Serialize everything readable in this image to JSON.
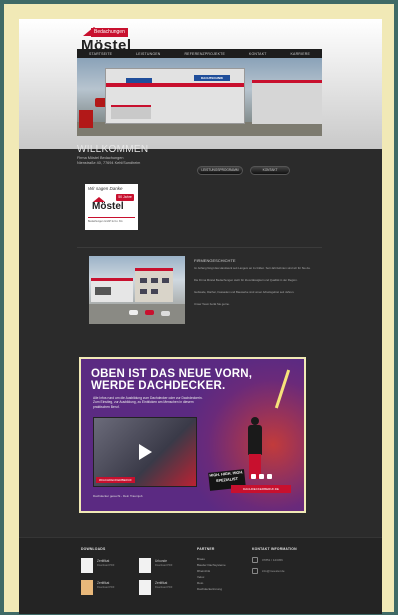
{
  "brand": {
    "tag": "Bedachungen",
    "name": "Möstel",
    "sub": "GmbH & Co. KG"
  },
  "nav": [
    "STARTSEITE",
    "LEISTUNGEN",
    "REFERENZPROJEKTE",
    "KONTAKT",
    "KARRIERE"
  ],
  "hero": {
    "building_sign": "DACHTECHNIK"
  },
  "welcome": {
    "title": "WILLKOMMEN",
    "line1": "Firma Möstel Bedachungen",
    "line2": "Nienstraße 40, 77694 Kehl/Sundheim",
    "btn_primary": "LEISTUNGSPROGRAMM",
    "btn_secondary": "KONTAKT"
  },
  "badge": {
    "script": "Wir sagen Danke",
    "jubilee": "50 Jahre",
    "name": "Möstel",
    "footer": "Bedachungen GmbH & Co. KG"
  },
  "firm": {
    "title": "FIRMENGESCHICHTE",
    "p1": "Im Anfang fängt das Handwerk seit Langem an zu bilden. Seit Jahrzehnten sind wir für Sie da.",
    "p2": "Die Firma Möstel Bedachungen steht für Zuverlässigkeit und Qualität in der Region.",
    "p3": "Gebäude, Dächer, Fassaden und Bauwerke sind unser Arbeitsgebiet seit Jahren.",
    "p4": "Unser Team berät Sie gerne."
  },
  "ad": {
    "headline1": "OBEN IST DAS NEUE VORN,",
    "headline2": "WERDE DACHDECKER.",
    "copy": "Alle Infos rund um die Ausbildung zum Dachdecker oder zur Dachdeckerin. Zum Einstieg, zur Ausbildung, zu Einblicken am Menschen in diesem praktischen Beruf.",
    "video_tag": "#DACHDECKERBERUF",
    "caption": "Dachdecker gesucht - Dein Traumjob",
    "stamp1": "HIGH. HIGH. HIGH.",
    "stamp2": "SPEZIALIST",
    "cta": "DACHDECKERBERUF.DE"
  },
  "footer": {
    "downloads_title": "DOWNLOADS",
    "partners_title": "PARTNER",
    "contact_title": "KONTAKT INFORMATION",
    "docs": [
      {
        "title": "Zertifikat",
        "sub": "Download PDF"
      },
      {
        "title": "Urkunde",
        "sub": "Download PDF"
      },
      {
        "title": "Zertifikat",
        "sub": "Download PDF"
      },
      {
        "title": "Zertifikat",
        "sub": "Download PDF"
      }
    ],
    "links": [
      "Braas",
      "Bauder Dachsysteme",
      "Rheinzink",
      "Velux",
      "Roto",
      "Dachdeckerinnung"
    ],
    "contact": {
      "phone": "07851 / 123456",
      "mail": "info@moestel.de"
    }
  }
}
